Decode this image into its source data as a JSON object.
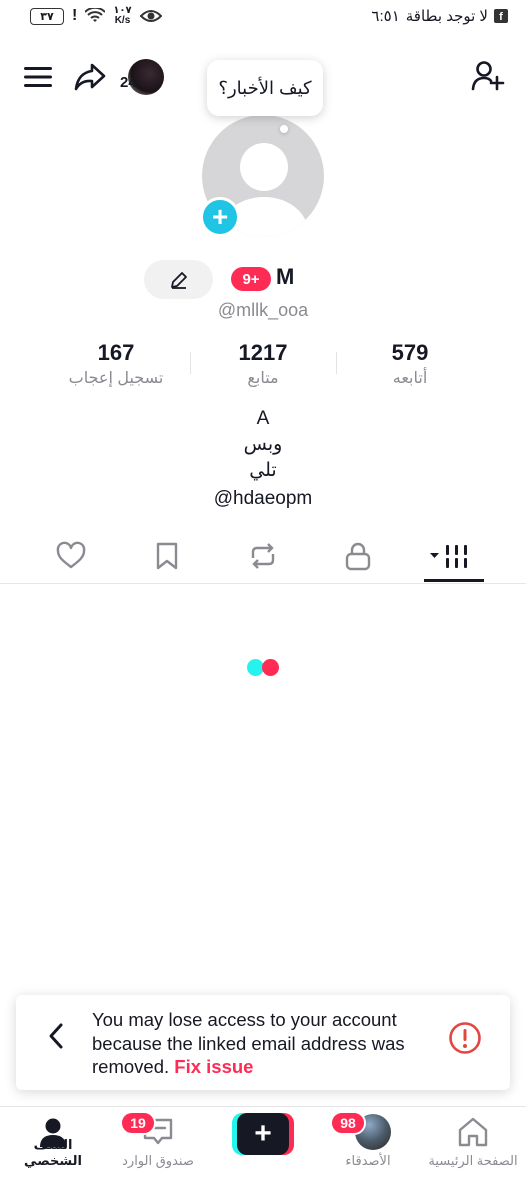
{
  "status_bar": {
    "battery": "٣٧",
    "speed_value": "١٠٧",
    "speed_unit": "K/s",
    "carrier": "لا توجد بطاقة",
    "time": "٦:٥١"
  },
  "top_bar": {
    "story_count": "24"
  },
  "tooltip": {
    "text": "كيف الأخبار؟"
  },
  "profile": {
    "notification_badge": "9+",
    "display_name": "M",
    "username": "@mllk_ooa"
  },
  "stats": [
    {
      "value": "579",
      "label": "أتابعه"
    },
    {
      "value": "1217",
      "label": "متابع"
    },
    {
      "value": "167",
      "label": "تسجيل إعجاب"
    }
  ],
  "bio": {
    "lines": [
      "A",
      "وبس",
      "تلي",
      "@hdaeopm"
    ]
  },
  "tabs": [
    {
      "name": "videos",
      "icon": "grid-icon",
      "active": true
    },
    {
      "name": "private",
      "icon": "lock-icon",
      "active": false
    },
    {
      "name": "reposts",
      "icon": "repost-icon",
      "active": false
    },
    {
      "name": "favorites",
      "icon": "bookmark-icon",
      "active": false
    },
    {
      "name": "liked",
      "icon": "heart-icon",
      "active": false
    }
  ],
  "toast": {
    "message": "You may lose access to your account because the linked email address was removed.",
    "action": "Fix issue"
  },
  "bottom_nav": {
    "home_label": "الصفحة الرئيسية",
    "friends_label": "الأصدقاء",
    "friends_badge": "98",
    "create_label": "+",
    "inbox_label": "صندوق الوارد",
    "inbox_badge": "19",
    "profile_label": "الملف الشخصي"
  },
  "colors": {
    "accent": "#fe2c55",
    "cyan": "#25f4ee",
    "avatar_add": "#20c4e4",
    "alert": "#e2463f"
  }
}
